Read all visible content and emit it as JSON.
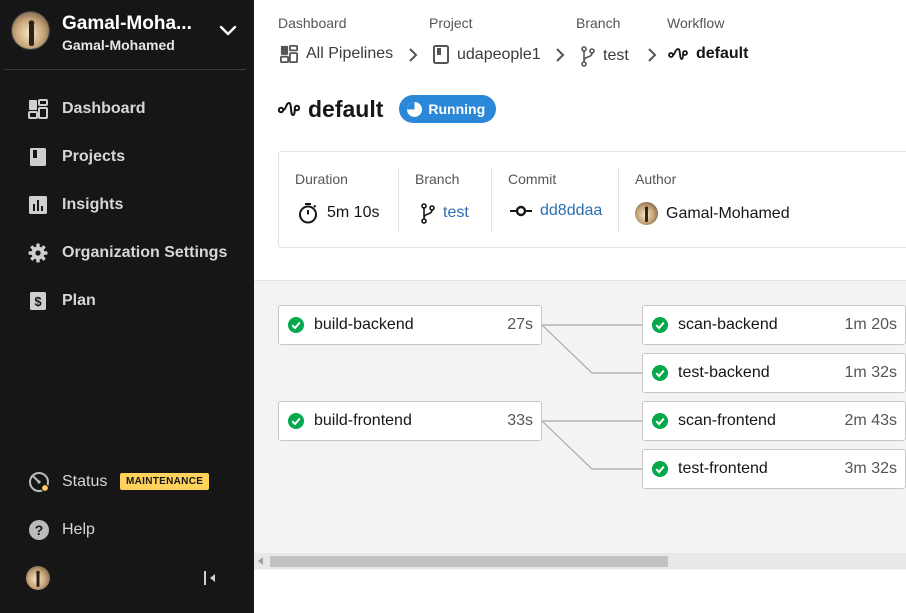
{
  "sidebar": {
    "user_name": "Gamal-Moha...",
    "org_name": "Gamal-Mohamed",
    "nav": [
      {
        "label": "Dashboard",
        "icon": "dashboard-icon"
      },
      {
        "label": "Projects",
        "icon": "projects-icon"
      },
      {
        "label": "Insights",
        "icon": "insights-icon"
      },
      {
        "label": "Organization Settings",
        "icon": "gear-icon"
      },
      {
        "label": "Plan",
        "icon": "dollar-icon"
      }
    ],
    "status_label": "Status",
    "status_badge": "MAINTENANCE",
    "help_label": "Help"
  },
  "breadcrumb": {
    "labels": [
      "Dashboard",
      "Project",
      "Branch",
      "Workflow"
    ],
    "values": [
      "All Pipelines",
      "udapeople1",
      "test",
      "default"
    ]
  },
  "workflow": {
    "title": "default",
    "status": "Running",
    "status_color": "#2b87d8"
  },
  "info": {
    "duration_label": "Duration",
    "duration": "5m 10s",
    "branch_label": "Branch",
    "branch": "test",
    "commit_label": "Commit",
    "commit": "dd8ddaa",
    "author_label": "Author",
    "author": "Gamal-Mohamed"
  },
  "jobs": [
    {
      "name": "build-backend",
      "duration": "27s",
      "status": "success"
    },
    {
      "name": "scan-backend",
      "duration": "1m 20s",
      "status": "success"
    },
    {
      "name": "test-backend",
      "duration": "1m 32s",
      "status": "success"
    },
    {
      "name": "build-frontend",
      "duration": "33s",
      "status": "success"
    },
    {
      "name": "scan-frontend",
      "duration": "2m 43s",
      "status": "success"
    },
    {
      "name": "test-frontend",
      "duration": "3m 32s",
      "status": "success"
    }
  ],
  "colors": {
    "sidebar_bg": "#161616",
    "success": "#04a94d",
    "link": "#2b6fb2",
    "maintenance": "#ffd25b"
  }
}
